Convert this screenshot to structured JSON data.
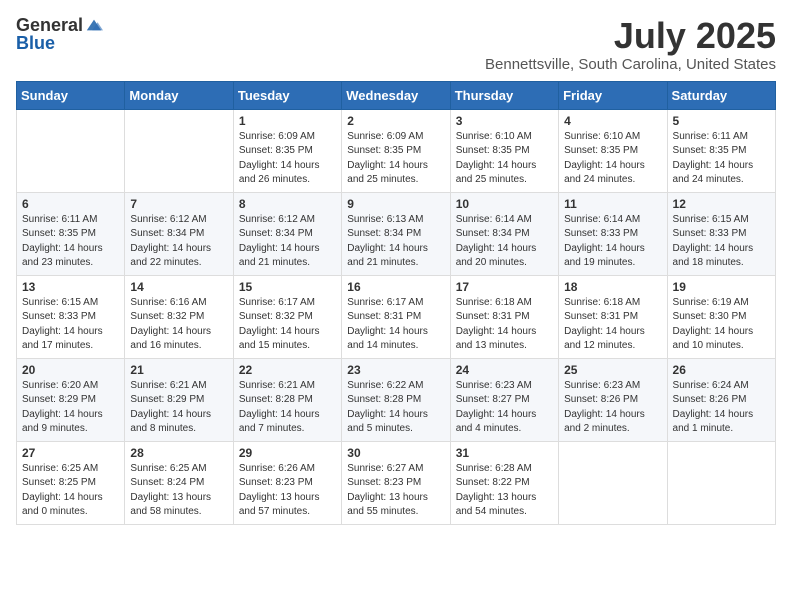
{
  "header": {
    "logo_general": "General",
    "logo_blue": "Blue",
    "month_title": "July 2025",
    "location": "Bennettsville, South Carolina, United States"
  },
  "weekdays": [
    "Sunday",
    "Monday",
    "Tuesday",
    "Wednesday",
    "Thursday",
    "Friday",
    "Saturday"
  ],
  "weeks": [
    [
      {
        "num": "",
        "info": ""
      },
      {
        "num": "",
        "info": ""
      },
      {
        "num": "1",
        "info": "Sunrise: 6:09 AM\nSunset: 8:35 PM\nDaylight: 14 hours and 26 minutes."
      },
      {
        "num": "2",
        "info": "Sunrise: 6:09 AM\nSunset: 8:35 PM\nDaylight: 14 hours and 25 minutes."
      },
      {
        "num": "3",
        "info": "Sunrise: 6:10 AM\nSunset: 8:35 PM\nDaylight: 14 hours and 25 minutes."
      },
      {
        "num": "4",
        "info": "Sunrise: 6:10 AM\nSunset: 8:35 PM\nDaylight: 14 hours and 24 minutes."
      },
      {
        "num": "5",
        "info": "Sunrise: 6:11 AM\nSunset: 8:35 PM\nDaylight: 14 hours and 24 minutes."
      }
    ],
    [
      {
        "num": "6",
        "info": "Sunrise: 6:11 AM\nSunset: 8:35 PM\nDaylight: 14 hours and 23 minutes."
      },
      {
        "num": "7",
        "info": "Sunrise: 6:12 AM\nSunset: 8:34 PM\nDaylight: 14 hours and 22 minutes."
      },
      {
        "num": "8",
        "info": "Sunrise: 6:12 AM\nSunset: 8:34 PM\nDaylight: 14 hours and 21 minutes."
      },
      {
        "num": "9",
        "info": "Sunrise: 6:13 AM\nSunset: 8:34 PM\nDaylight: 14 hours and 21 minutes."
      },
      {
        "num": "10",
        "info": "Sunrise: 6:14 AM\nSunset: 8:34 PM\nDaylight: 14 hours and 20 minutes."
      },
      {
        "num": "11",
        "info": "Sunrise: 6:14 AM\nSunset: 8:33 PM\nDaylight: 14 hours and 19 minutes."
      },
      {
        "num": "12",
        "info": "Sunrise: 6:15 AM\nSunset: 8:33 PM\nDaylight: 14 hours and 18 minutes."
      }
    ],
    [
      {
        "num": "13",
        "info": "Sunrise: 6:15 AM\nSunset: 8:33 PM\nDaylight: 14 hours and 17 minutes."
      },
      {
        "num": "14",
        "info": "Sunrise: 6:16 AM\nSunset: 8:32 PM\nDaylight: 14 hours and 16 minutes."
      },
      {
        "num": "15",
        "info": "Sunrise: 6:17 AM\nSunset: 8:32 PM\nDaylight: 14 hours and 15 minutes."
      },
      {
        "num": "16",
        "info": "Sunrise: 6:17 AM\nSunset: 8:31 PM\nDaylight: 14 hours and 14 minutes."
      },
      {
        "num": "17",
        "info": "Sunrise: 6:18 AM\nSunset: 8:31 PM\nDaylight: 14 hours and 13 minutes."
      },
      {
        "num": "18",
        "info": "Sunrise: 6:18 AM\nSunset: 8:31 PM\nDaylight: 14 hours and 12 minutes."
      },
      {
        "num": "19",
        "info": "Sunrise: 6:19 AM\nSunset: 8:30 PM\nDaylight: 14 hours and 10 minutes."
      }
    ],
    [
      {
        "num": "20",
        "info": "Sunrise: 6:20 AM\nSunset: 8:29 PM\nDaylight: 14 hours and 9 minutes."
      },
      {
        "num": "21",
        "info": "Sunrise: 6:21 AM\nSunset: 8:29 PM\nDaylight: 14 hours and 8 minutes."
      },
      {
        "num": "22",
        "info": "Sunrise: 6:21 AM\nSunset: 8:28 PM\nDaylight: 14 hours and 7 minutes."
      },
      {
        "num": "23",
        "info": "Sunrise: 6:22 AM\nSunset: 8:28 PM\nDaylight: 14 hours and 5 minutes."
      },
      {
        "num": "24",
        "info": "Sunrise: 6:23 AM\nSunset: 8:27 PM\nDaylight: 14 hours and 4 minutes."
      },
      {
        "num": "25",
        "info": "Sunrise: 6:23 AM\nSunset: 8:26 PM\nDaylight: 14 hours and 2 minutes."
      },
      {
        "num": "26",
        "info": "Sunrise: 6:24 AM\nSunset: 8:26 PM\nDaylight: 14 hours and 1 minute."
      }
    ],
    [
      {
        "num": "27",
        "info": "Sunrise: 6:25 AM\nSunset: 8:25 PM\nDaylight: 14 hours and 0 minutes."
      },
      {
        "num": "28",
        "info": "Sunrise: 6:25 AM\nSunset: 8:24 PM\nDaylight: 13 hours and 58 minutes."
      },
      {
        "num": "29",
        "info": "Sunrise: 6:26 AM\nSunset: 8:23 PM\nDaylight: 13 hours and 57 minutes."
      },
      {
        "num": "30",
        "info": "Sunrise: 6:27 AM\nSunset: 8:23 PM\nDaylight: 13 hours and 55 minutes."
      },
      {
        "num": "31",
        "info": "Sunrise: 6:28 AM\nSunset: 8:22 PM\nDaylight: 13 hours and 54 minutes."
      },
      {
        "num": "",
        "info": ""
      },
      {
        "num": "",
        "info": ""
      }
    ]
  ]
}
